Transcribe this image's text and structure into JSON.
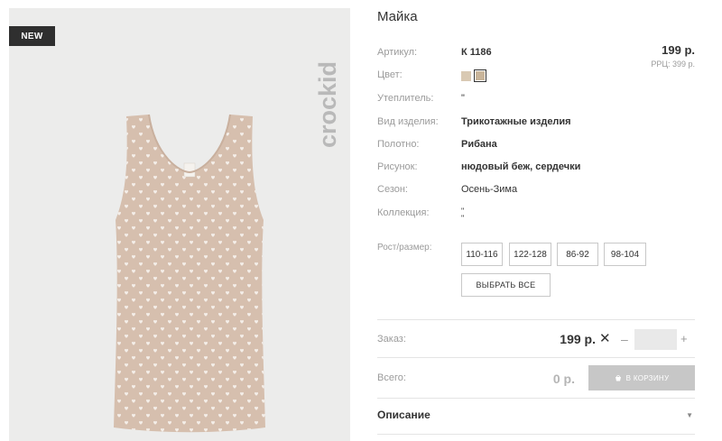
{
  "image": {
    "badge": "NEW",
    "brand": "crockid"
  },
  "product": {
    "title": "Майка",
    "price": "199 р.",
    "rrp": "РРЦ: 399 р.",
    "specs": [
      {
        "label": "Артикул:",
        "value": "К 1186",
        "bold": true
      },
      {
        "label": "Цвет:",
        "value": ""
      },
      {
        "label": "Утеплитель:",
        "value": "\""
      },
      {
        "label": "Вид изделия:",
        "value": "Трикотажные изделия",
        "bold": true
      },
      {
        "label": "Полотно:",
        "value": "Рибана",
        "bold": true
      },
      {
        "label": "Рисунок:",
        "value": "нюдовый беж, сердечки",
        "bold": true
      },
      {
        "label": "Сезон:",
        "value": "Осень-Зима"
      },
      {
        "label": "Коллекция:",
        "value": "\"\n\""
      }
    ],
    "colors": [
      "#d9c9b3",
      "#c9b59a"
    ]
  },
  "sizes": {
    "label": "Рост/размер:",
    "options": [
      "110-116",
      "122-128",
      "86-92",
      "98-104"
    ],
    "select_all": "ВЫБРАТЬ ВСЕ"
  },
  "order": {
    "label": "Заказ:",
    "price": "199 р.",
    "times": "✕",
    "minus": "–",
    "plus": "+",
    "quantity": ""
  },
  "total": {
    "label": "Всего:",
    "value": "0 р.",
    "cart_button": "В КОРЗИНУ"
  },
  "description": {
    "label": "Описание",
    "arrow": "▼"
  }
}
